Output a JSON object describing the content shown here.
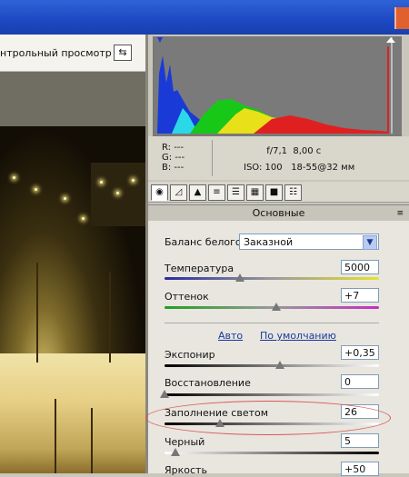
{
  "toolbar": {
    "preview_label": "нтрольный просмотр",
    "toggle_icon": "swap-icon"
  },
  "info": {
    "r_label": "R:",
    "g_label": "G:",
    "b_label": "B:",
    "r_value": "---",
    "g_value": "---",
    "b_value": "---",
    "aperture": "f/7,1",
    "shutter": "8,00 с",
    "iso": "ISO: 100",
    "lens": "18-55@32 мм"
  },
  "tabs": [
    "aperture-icon",
    "curve-icon",
    "detail-icon",
    "hsl-icon",
    "split-icon",
    "lens-icon",
    "camera-icon",
    "presets-icon"
  ],
  "section": {
    "title": "Основные"
  },
  "white_balance": {
    "label": "Баланс белого:",
    "value": "Заказной"
  },
  "sliders": {
    "temperature": {
      "label": "Температура",
      "value": "5000",
      "level": 0.35
    },
    "tint": {
      "label": "Оттенок",
      "value": "+7",
      "level": 0.52
    },
    "exposure": {
      "label": "Экспонир",
      "value": "+0,35",
      "level": 0.54
    },
    "recovery": {
      "label": "Восстановление",
      "value": "0",
      "level": 0.0
    },
    "fill_light": {
      "label": "Заполнение светом",
      "value": "26",
      "level": 0.26
    },
    "blacks": {
      "label": "Черный",
      "value": "5",
      "level": 0.05
    },
    "brightness": {
      "label": "Яркость",
      "value": "+50"
    }
  },
  "links": {
    "auto": "Авто",
    "default": "По умолчанию"
  },
  "colors": {
    "accent_blue": "#1d48c2",
    "highlight": "#d85858"
  }
}
